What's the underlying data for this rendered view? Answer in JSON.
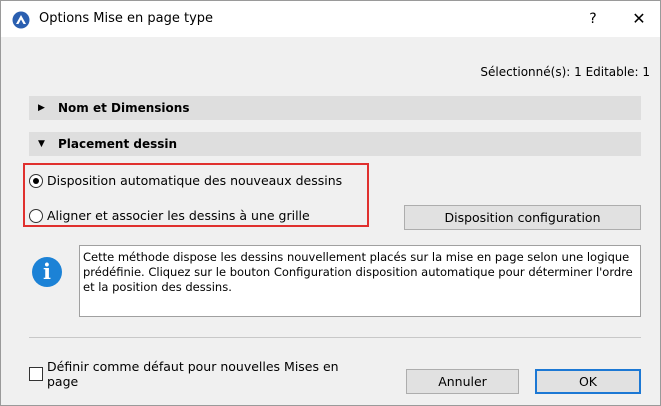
{
  "window": {
    "title": "Options Mise en page type",
    "help_label": "?",
    "close_label": "✕"
  },
  "selection_info": "Sélectionné(s): 1 Editable: 1",
  "sections": [
    {
      "title": "Nom et Dimensions",
      "expanded": false
    },
    {
      "title": "Placement dessin",
      "expanded": true
    }
  ],
  "placement": {
    "radio_options": [
      {
        "label": "Disposition automatique des nouveaux dessins",
        "checked": true
      },
      {
        "label": "Aligner et associer les dessins à une grille",
        "checked": false
      }
    ],
    "config_button_label": "Disposition configuration",
    "info_text": "Cette méthode dispose les dessins nouvellement placés sur la mise en page selon une logique prédéfinie. Cliquez sur le bouton Configuration disposition automatique pour déterminer l'ordre et la position des dessins."
  },
  "footer": {
    "default_checkbox_label": "Définir comme défaut pour nouvelles Mises en page",
    "default_checkbox_checked": false,
    "cancel_label": "Annuler",
    "ok_label": "OK"
  },
  "icons": {
    "app": "archicad-app-icon",
    "info": "info-icon",
    "section_collapsed": "triangle-right-icon",
    "section_expanded": "triangle-down-icon"
  },
  "colors": {
    "highlight_box": "#e0302e",
    "info_icon": "#1c82d6",
    "ok_border": "#1c78d4"
  }
}
